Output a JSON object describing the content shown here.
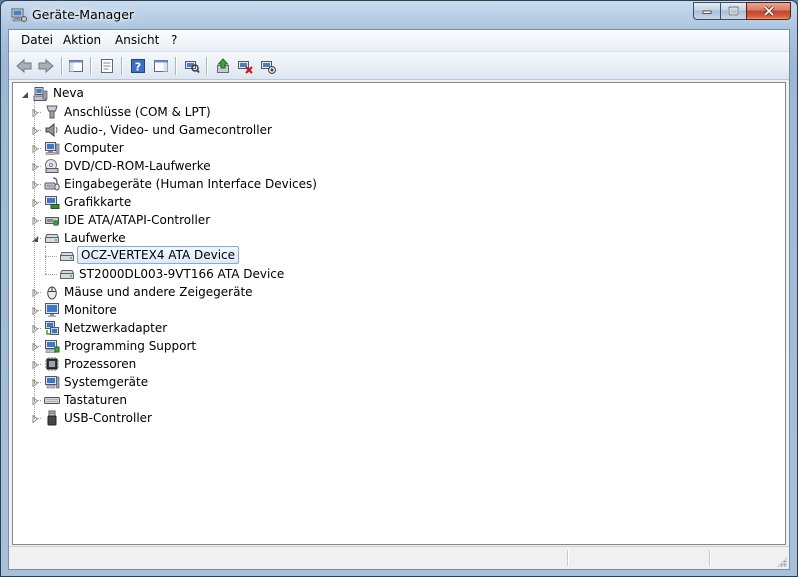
{
  "window": {
    "title": "Geräte-Manager",
    "accent": "#a9c4df"
  },
  "menu": [
    {
      "label": "Datei"
    },
    {
      "label": "Aktion"
    },
    {
      "label": "Ansicht"
    },
    {
      "label": "?"
    }
  ],
  "toolbar": {
    "buttons": [
      "back-arrow-icon",
      "forward-arrow-icon",
      "console-tree-icon",
      "properties-icon",
      "help-icon",
      "action-pane-icon",
      "scan-hardware-icon",
      "update-driver-icon",
      "uninstall-device-icon",
      "disable-device-icon"
    ]
  },
  "tree": {
    "root": "Neva",
    "categories": [
      {
        "label": "Anschlüsse (COM & LPT)",
        "icon": "port-icon"
      },
      {
        "label": "Audio-, Video- und Gamecontroller",
        "icon": "speaker-icon"
      },
      {
        "label": "Computer",
        "icon": "computer-icon"
      },
      {
        "label": "DVD/CD-ROM-Laufwerke",
        "icon": "dvd-drive-icon"
      },
      {
        "label": "Eingabegeräte (Human Interface Devices)",
        "icon": "hid-icon"
      },
      {
        "label": "Grafikkarte",
        "icon": "display-adapter-icon"
      },
      {
        "label": "IDE ATA/ATAPI-Controller",
        "icon": "ide-controller-icon"
      },
      {
        "label": "Laufwerke",
        "icon": "disk-drive-icon",
        "expanded": true,
        "children": [
          {
            "label": "OCZ-VERTEX4 ATA Device",
            "icon": "disk-drive-icon",
            "selected": true
          },
          {
            "label": "ST2000DL003-9VT166 ATA Device",
            "icon": "disk-drive-icon"
          }
        ]
      },
      {
        "label": "Mäuse und andere Zeigegeräte",
        "icon": "mouse-icon"
      },
      {
        "label": "Monitore",
        "icon": "monitor-icon"
      },
      {
        "label": "Netzwerkadapter",
        "icon": "network-adapter-icon"
      },
      {
        "label": "Programming Support",
        "icon": "programming-icon"
      },
      {
        "label": "Prozessoren",
        "icon": "processor-icon"
      },
      {
        "label": "Systemgeräte",
        "icon": "system-devices-icon"
      },
      {
        "label": "Tastaturen",
        "icon": "keyboard-icon"
      },
      {
        "label": "USB-Controller",
        "icon": "usb-icon"
      }
    ]
  }
}
